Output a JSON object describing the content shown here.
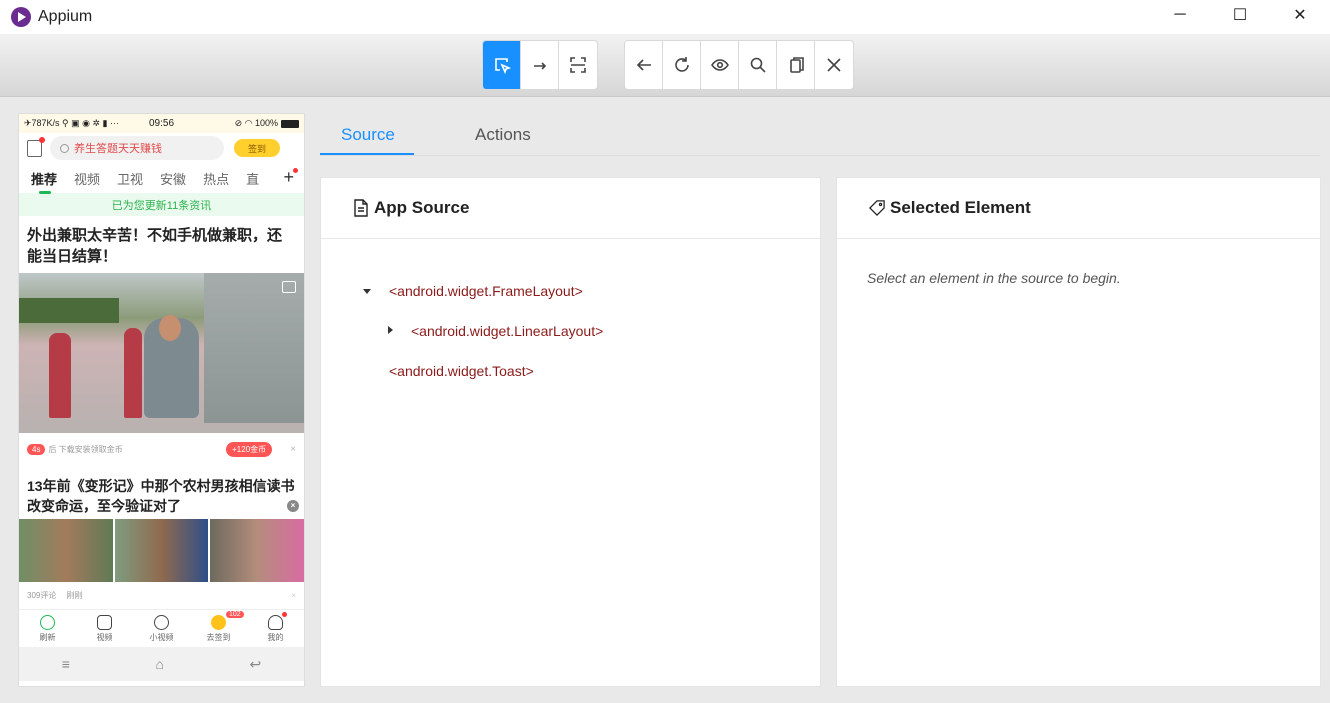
{
  "window": {
    "title": "Appium",
    "controls": [
      "─",
      "☐",
      "✕"
    ]
  },
  "toolbar": {
    "group1": [
      {
        "name": "select-elements-icon",
        "active": true
      },
      {
        "name": "swipe-icon",
        "active": false
      },
      {
        "name": "tap-by-coordinates-icon",
        "active": false
      }
    ],
    "group2": [
      {
        "name": "back-icon"
      },
      {
        "name": "refresh-icon"
      },
      {
        "name": "eye-icon"
      },
      {
        "name": "search-icon"
      },
      {
        "name": "copy-icon"
      },
      {
        "name": "close-icon"
      }
    ]
  },
  "phone": {
    "status_left": "✈787K/s ⚲ ▣ ◉ ✲ ▮ ···",
    "status_time": "09:56",
    "status_right": "⊘ ◠ 100%",
    "search_placeholder": "养生答题天天赚钱",
    "sign_label": "签到",
    "tabs": [
      "推荐",
      "视频",
      "卫视",
      "安徽",
      "热点",
      "直"
    ],
    "plus": "+",
    "notice": "已为您更新11条资讯",
    "headline1": "外出兼职太辛苦！不如手机做兼职，还能当日结算！",
    "ad_badge": "4s",
    "ad_text": "后 下载安装领取金币",
    "ad_coins": "+120金币",
    "ad_close": "×",
    "headline2": "13年前《变形记》中那个农村男孩相信读书改变命运，至今验证对了",
    "close_circle": "×",
    "meta_comments": "309评论",
    "meta_time": "刚刚",
    "meta_close": "×",
    "nav": [
      {
        "label": "刷新"
      },
      {
        "label": "视频"
      },
      {
        "label": "小视频"
      },
      {
        "label": "去签到",
        "badge": "102"
      },
      {
        "label": "我的"
      }
    ],
    "sysnav": [
      "≡",
      "⌂",
      "↩"
    ]
  },
  "tabs": {
    "source": "Source",
    "actions": "Actions"
  },
  "app_source": {
    "title": "App Source",
    "nodes": [
      "<android.widget.FrameLayout>",
      "<android.widget.LinearLayout>",
      "<android.widget.Toast>"
    ]
  },
  "selected_element": {
    "title": "Selected Element",
    "hint": "Select an element in the source to begin."
  },
  "colors": {
    "accent": "#1890ff",
    "tree_text": "#8b1a1a"
  }
}
